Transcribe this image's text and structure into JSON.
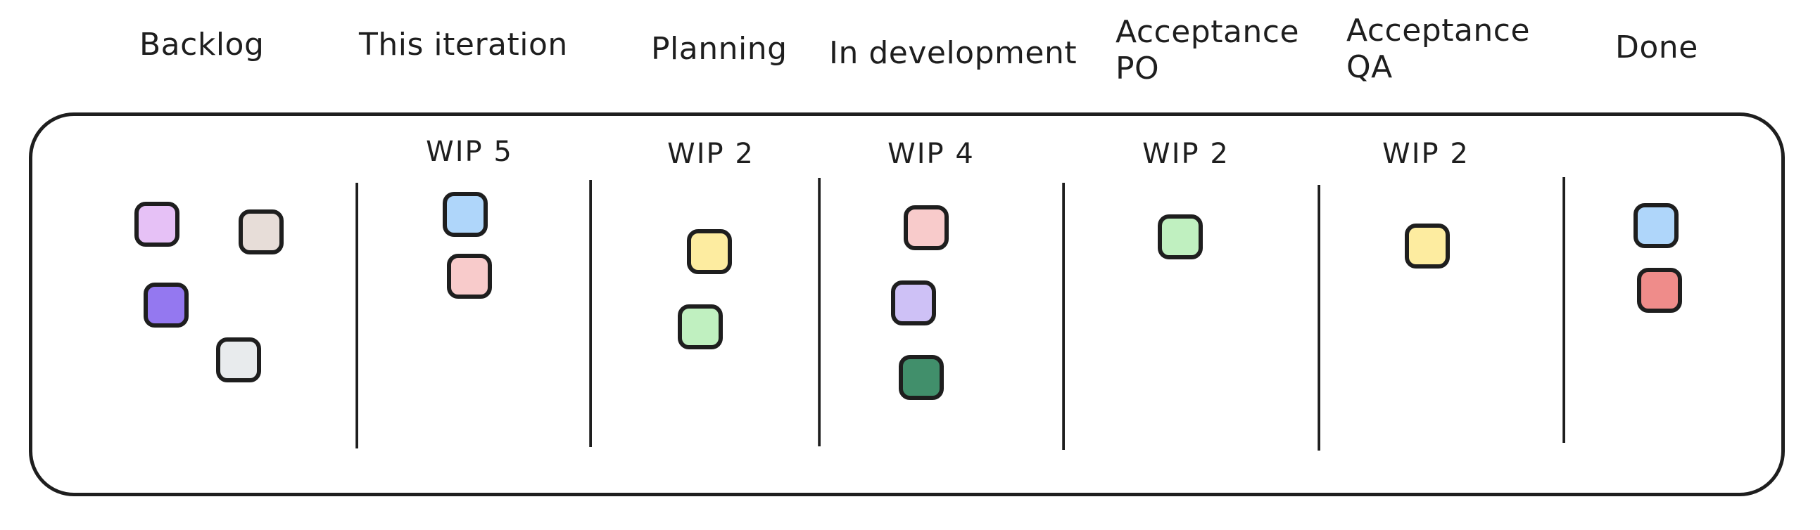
{
  "columns": [
    {
      "title": "Backlog",
      "wip": null
    },
    {
      "title": "This iteration",
      "wip": "WIP 5"
    },
    {
      "title": "Planning",
      "wip": "WIP 2"
    },
    {
      "title": "In development",
      "wip": "WIP 4"
    },
    {
      "title": "Acceptance\nPO",
      "wip": "WIP 2"
    },
    {
      "title": "Acceptance\nQA",
      "wip": "WIP 2"
    },
    {
      "title": "Done",
      "wip": null
    }
  ],
  "cards": [
    {
      "column": "Backlog",
      "color": "#e6c1f6"
    },
    {
      "column": "Backlog",
      "color": "#e7ddd8"
    },
    {
      "column": "Backlog",
      "color": "#9478f0"
    },
    {
      "column": "Backlog",
      "color": "#e8ebed"
    },
    {
      "column": "This iteration",
      "color": "#afd6fa"
    },
    {
      "column": "This iteration",
      "color": "#f8cbcb"
    },
    {
      "column": "Planning",
      "color": "#fdeca0"
    },
    {
      "column": "Planning",
      "color": "#c0f0c0"
    },
    {
      "column": "In development",
      "color": "#f8cbcb"
    },
    {
      "column": "In development",
      "color": "#cec1f6"
    },
    {
      "column": "In development",
      "color": "#418f6b"
    },
    {
      "column": "Acceptance PO",
      "color": "#c0f0c0"
    },
    {
      "column": "Acceptance QA",
      "color": "#fdeca0"
    },
    {
      "column": "Done",
      "color": "#afd6fa"
    },
    {
      "column": "Done",
      "color": "#ef8c8a"
    }
  ]
}
